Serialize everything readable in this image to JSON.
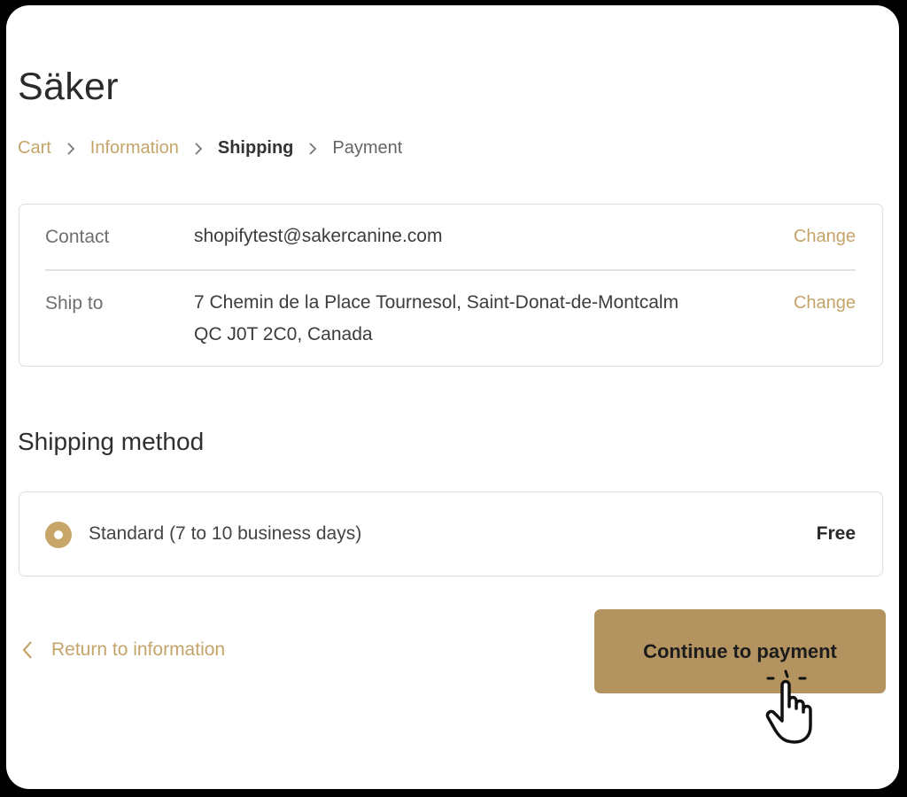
{
  "store": {
    "name": "Säker"
  },
  "breadcrumb": {
    "items": [
      {
        "label": "Cart",
        "state": "link"
      },
      {
        "label": "Information",
        "state": "link"
      },
      {
        "label": "Shipping",
        "state": "current"
      },
      {
        "label": "Payment",
        "state": "future"
      }
    ],
    "separator_icon": "chevron-right-icon"
  },
  "review": {
    "contact": {
      "label": "Contact",
      "value": "shopifytest@sakercanine.com",
      "change_label": "Change"
    },
    "ship_to": {
      "label": "Ship to",
      "value_line1": "7 Chemin de la Place Tournesol, Saint-Donat-de-Montcalm",
      "value_line2": "QC J0T 2C0, Canada",
      "change_label": "Change"
    }
  },
  "shipping_method": {
    "title": "Shipping method",
    "options": [
      {
        "label": "Standard (7 to 10 business days)",
        "price": "Free",
        "selected": true
      }
    ]
  },
  "actions": {
    "return_label": "Return to information",
    "continue_label": "Continue to payment"
  },
  "colors": {
    "accent": "#c5a46a",
    "button": "#b39360",
    "text_dark": "#2b2b2b"
  }
}
